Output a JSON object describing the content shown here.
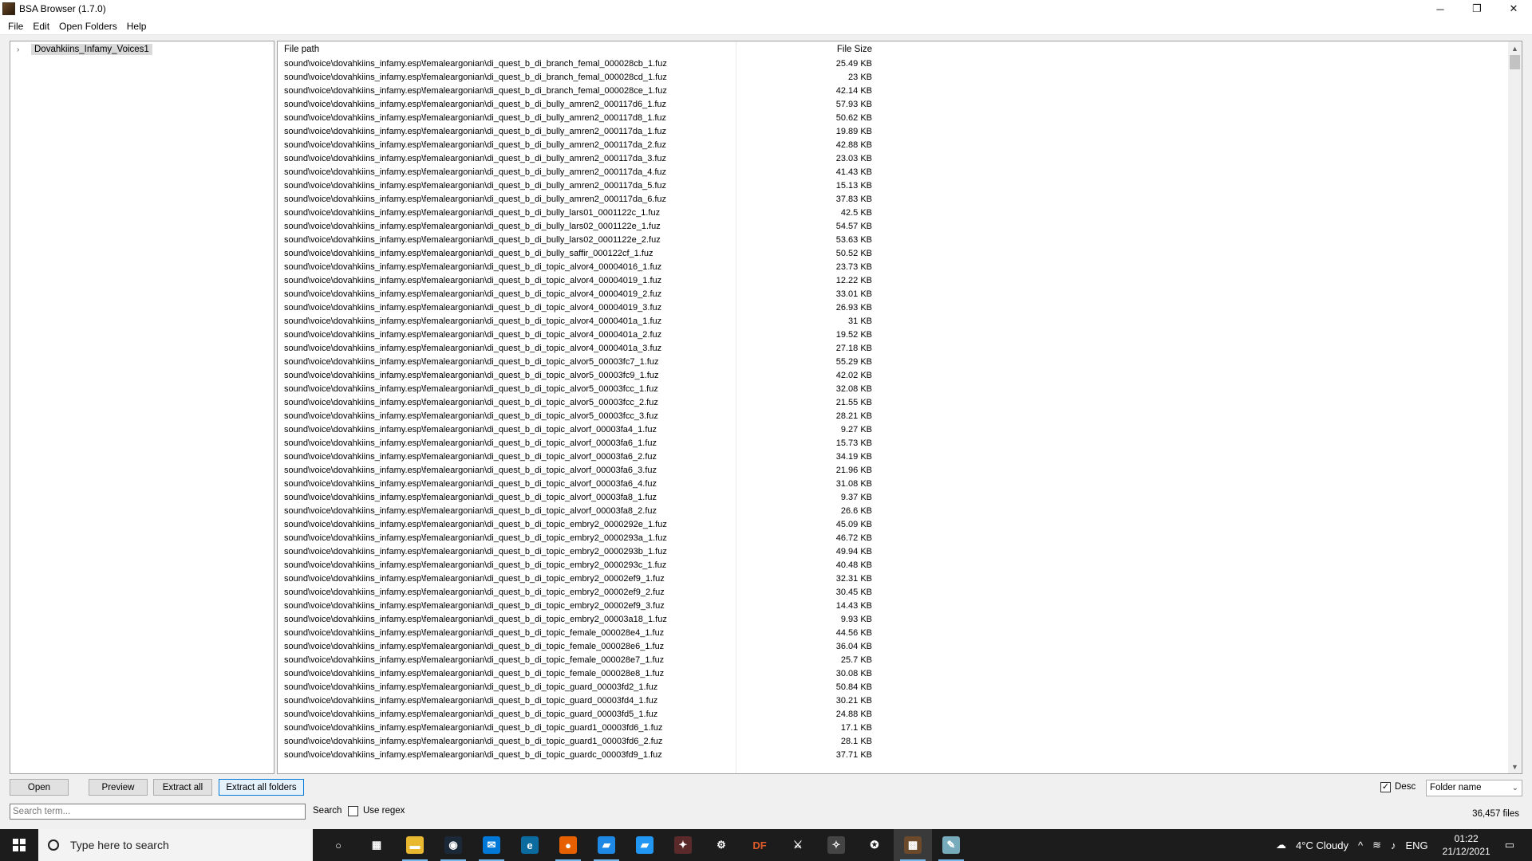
{
  "window": {
    "title": "BSA Browser (1.7.0)",
    "controls": {
      "minimize": "─",
      "maximize": "❐",
      "close": "✕"
    }
  },
  "menu": {
    "items": [
      "File",
      "Edit",
      "Open Folders",
      "Help"
    ]
  },
  "tree": {
    "root_label": "Dovahkiins_Infamy_Voices1",
    "expand_glyph": "›"
  },
  "list": {
    "headers": {
      "path": "File path",
      "size": "File Size"
    },
    "rows": [
      {
        "path": "sound\\voice\\dovahkiins_infamy.esp\\femaleargonian\\di_quest_b_di_branch_femal_000028cb_1.fuz",
        "size": "25.49 KB"
      },
      {
        "path": "sound\\voice\\dovahkiins_infamy.esp\\femaleargonian\\di_quest_b_di_branch_femal_000028cd_1.fuz",
        "size": "23 KB"
      },
      {
        "path": "sound\\voice\\dovahkiins_infamy.esp\\femaleargonian\\di_quest_b_di_branch_femal_000028ce_1.fuz",
        "size": "42.14 KB"
      },
      {
        "path": "sound\\voice\\dovahkiins_infamy.esp\\femaleargonian\\di_quest_b_di_bully_amren2_000117d6_1.fuz",
        "size": "57.93 KB"
      },
      {
        "path": "sound\\voice\\dovahkiins_infamy.esp\\femaleargonian\\di_quest_b_di_bully_amren2_000117d8_1.fuz",
        "size": "50.62 KB"
      },
      {
        "path": "sound\\voice\\dovahkiins_infamy.esp\\femaleargonian\\di_quest_b_di_bully_amren2_000117da_1.fuz",
        "size": "19.89 KB"
      },
      {
        "path": "sound\\voice\\dovahkiins_infamy.esp\\femaleargonian\\di_quest_b_di_bully_amren2_000117da_2.fuz",
        "size": "42.88 KB"
      },
      {
        "path": "sound\\voice\\dovahkiins_infamy.esp\\femaleargonian\\di_quest_b_di_bully_amren2_000117da_3.fuz",
        "size": "23.03 KB"
      },
      {
        "path": "sound\\voice\\dovahkiins_infamy.esp\\femaleargonian\\di_quest_b_di_bully_amren2_000117da_4.fuz",
        "size": "41.43 KB"
      },
      {
        "path": "sound\\voice\\dovahkiins_infamy.esp\\femaleargonian\\di_quest_b_di_bully_amren2_000117da_5.fuz",
        "size": "15.13 KB"
      },
      {
        "path": "sound\\voice\\dovahkiins_infamy.esp\\femaleargonian\\di_quest_b_di_bully_amren2_000117da_6.fuz",
        "size": "37.83 KB"
      },
      {
        "path": "sound\\voice\\dovahkiins_infamy.esp\\femaleargonian\\di_quest_b_di_bully_lars01_0001122c_1.fuz",
        "size": "42.5 KB"
      },
      {
        "path": "sound\\voice\\dovahkiins_infamy.esp\\femaleargonian\\di_quest_b_di_bully_lars02_0001122e_1.fuz",
        "size": "54.57 KB"
      },
      {
        "path": "sound\\voice\\dovahkiins_infamy.esp\\femaleargonian\\di_quest_b_di_bully_lars02_0001122e_2.fuz",
        "size": "53.63 KB"
      },
      {
        "path": "sound\\voice\\dovahkiins_infamy.esp\\femaleargonian\\di_quest_b_di_bully_saffir_000122cf_1.fuz",
        "size": "50.52 KB"
      },
      {
        "path": "sound\\voice\\dovahkiins_infamy.esp\\femaleargonian\\di_quest_b_di_topic_alvor4_00004016_1.fuz",
        "size": "23.73 KB"
      },
      {
        "path": "sound\\voice\\dovahkiins_infamy.esp\\femaleargonian\\di_quest_b_di_topic_alvor4_00004019_1.fuz",
        "size": "12.22 KB"
      },
      {
        "path": "sound\\voice\\dovahkiins_infamy.esp\\femaleargonian\\di_quest_b_di_topic_alvor4_00004019_2.fuz",
        "size": "33.01 KB"
      },
      {
        "path": "sound\\voice\\dovahkiins_infamy.esp\\femaleargonian\\di_quest_b_di_topic_alvor4_00004019_3.fuz",
        "size": "26.93 KB"
      },
      {
        "path": "sound\\voice\\dovahkiins_infamy.esp\\femaleargonian\\di_quest_b_di_topic_alvor4_0000401a_1.fuz",
        "size": "31 KB"
      },
      {
        "path": "sound\\voice\\dovahkiins_infamy.esp\\femaleargonian\\di_quest_b_di_topic_alvor4_0000401a_2.fuz",
        "size": "19.52 KB"
      },
      {
        "path": "sound\\voice\\dovahkiins_infamy.esp\\femaleargonian\\di_quest_b_di_topic_alvor4_0000401a_3.fuz",
        "size": "27.18 KB"
      },
      {
        "path": "sound\\voice\\dovahkiins_infamy.esp\\femaleargonian\\di_quest_b_di_topic_alvor5_00003fc7_1.fuz",
        "size": "55.29 KB"
      },
      {
        "path": "sound\\voice\\dovahkiins_infamy.esp\\femaleargonian\\di_quest_b_di_topic_alvor5_00003fc9_1.fuz",
        "size": "42.02 KB"
      },
      {
        "path": "sound\\voice\\dovahkiins_infamy.esp\\femaleargonian\\di_quest_b_di_topic_alvor5_00003fcc_1.fuz",
        "size": "32.08 KB"
      },
      {
        "path": "sound\\voice\\dovahkiins_infamy.esp\\femaleargonian\\di_quest_b_di_topic_alvor5_00003fcc_2.fuz",
        "size": "21.55 KB"
      },
      {
        "path": "sound\\voice\\dovahkiins_infamy.esp\\femaleargonian\\di_quest_b_di_topic_alvor5_00003fcc_3.fuz",
        "size": "28.21 KB"
      },
      {
        "path": "sound\\voice\\dovahkiins_infamy.esp\\femaleargonian\\di_quest_b_di_topic_alvorf_00003fa4_1.fuz",
        "size": "9.27 KB"
      },
      {
        "path": "sound\\voice\\dovahkiins_infamy.esp\\femaleargonian\\di_quest_b_di_topic_alvorf_00003fa6_1.fuz",
        "size": "15.73 KB"
      },
      {
        "path": "sound\\voice\\dovahkiins_infamy.esp\\femaleargonian\\di_quest_b_di_topic_alvorf_00003fa6_2.fuz",
        "size": "34.19 KB"
      },
      {
        "path": "sound\\voice\\dovahkiins_infamy.esp\\femaleargonian\\di_quest_b_di_topic_alvorf_00003fa6_3.fuz",
        "size": "21.96 KB"
      },
      {
        "path": "sound\\voice\\dovahkiins_infamy.esp\\femaleargonian\\di_quest_b_di_topic_alvorf_00003fa6_4.fuz",
        "size": "31.08 KB"
      },
      {
        "path": "sound\\voice\\dovahkiins_infamy.esp\\femaleargonian\\di_quest_b_di_topic_alvorf_00003fa8_1.fuz",
        "size": "9.37 KB"
      },
      {
        "path": "sound\\voice\\dovahkiins_infamy.esp\\femaleargonian\\di_quest_b_di_topic_alvorf_00003fa8_2.fuz",
        "size": "26.6 KB"
      },
      {
        "path": "sound\\voice\\dovahkiins_infamy.esp\\femaleargonian\\di_quest_b_di_topic_embry2_0000292e_1.fuz",
        "size": "45.09 KB"
      },
      {
        "path": "sound\\voice\\dovahkiins_infamy.esp\\femaleargonian\\di_quest_b_di_topic_embry2_0000293a_1.fuz",
        "size": "46.72 KB"
      },
      {
        "path": "sound\\voice\\dovahkiins_infamy.esp\\femaleargonian\\di_quest_b_di_topic_embry2_0000293b_1.fuz",
        "size": "49.94 KB"
      },
      {
        "path": "sound\\voice\\dovahkiins_infamy.esp\\femaleargonian\\di_quest_b_di_topic_embry2_0000293c_1.fuz",
        "size": "40.48 KB"
      },
      {
        "path": "sound\\voice\\dovahkiins_infamy.esp\\femaleargonian\\di_quest_b_di_topic_embry2_00002ef9_1.fuz",
        "size": "32.31 KB"
      },
      {
        "path": "sound\\voice\\dovahkiins_infamy.esp\\femaleargonian\\di_quest_b_di_topic_embry2_00002ef9_2.fuz",
        "size": "30.45 KB"
      },
      {
        "path": "sound\\voice\\dovahkiins_infamy.esp\\femaleargonian\\di_quest_b_di_topic_embry2_00002ef9_3.fuz",
        "size": "14.43 KB"
      },
      {
        "path": "sound\\voice\\dovahkiins_infamy.esp\\femaleargonian\\di_quest_b_di_topic_embry2_00003a18_1.fuz",
        "size": "9.93 KB"
      },
      {
        "path": "sound\\voice\\dovahkiins_infamy.esp\\femaleargonian\\di_quest_b_di_topic_female_000028e4_1.fuz",
        "size": "44.56 KB"
      },
      {
        "path": "sound\\voice\\dovahkiins_infamy.esp\\femaleargonian\\di_quest_b_di_topic_female_000028e6_1.fuz",
        "size": "36.04 KB"
      },
      {
        "path": "sound\\voice\\dovahkiins_infamy.esp\\femaleargonian\\di_quest_b_di_topic_female_000028e7_1.fuz",
        "size": "25.7 KB"
      },
      {
        "path": "sound\\voice\\dovahkiins_infamy.esp\\femaleargonian\\di_quest_b_di_topic_female_000028e8_1.fuz",
        "size": "30.08 KB"
      },
      {
        "path": "sound\\voice\\dovahkiins_infamy.esp\\femaleargonian\\di_quest_b_di_topic_guard_00003fd2_1.fuz",
        "size": "50.84 KB"
      },
      {
        "path": "sound\\voice\\dovahkiins_infamy.esp\\femaleargonian\\di_quest_b_di_topic_guard_00003fd4_1.fuz",
        "size": "30.21 KB"
      },
      {
        "path": "sound\\voice\\dovahkiins_infamy.esp\\femaleargonian\\di_quest_b_di_topic_guard_00003fd5_1.fuz",
        "size": "24.88 KB"
      },
      {
        "path": "sound\\voice\\dovahkiins_infamy.esp\\femaleargonian\\di_quest_b_di_topic_guard1_00003fd6_1.fuz",
        "size": "17.1 KB"
      },
      {
        "path": "sound\\voice\\dovahkiins_infamy.esp\\femaleargonian\\di_quest_b_di_topic_guard1_00003fd6_2.fuz",
        "size": "28.1 KB"
      },
      {
        "path": "sound\\voice\\dovahkiins_infamy.esp\\femaleargonian\\di_quest_b_di_topic_guardc_00003fd9_1.fuz",
        "size": "37.71 KB"
      }
    ]
  },
  "buttons": {
    "open": "Open",
    "preview": "Preview",
    "extract_all": "Extract all",
    "extract_all_folders": "Extract all folders"
  },
  "sort": {
    "desc_label": "Desc",
    "desc_checked": true,
    "check_glyph": "✓",
    "combo_value": "Folder name",
    "combo_arrow": "⌄"
  },
  "search": {
    "placeholder": "Search term...",
    "label": "Search",
    "regex_label": "Use regex"
  },
  "status": {
    "file_count": "36,457 files"
  },
  "taskbar": {
    "search_placeholder": "Type here to search",
    "apps": [
      {
        "name": "cortana-icon",
        "glyph": "○",
        "color": "transparent"
      },
      {
        "name": "task-view-icon",
        "glyph": "▦",
        "color": "transparent"
      },
      {
        "name": "file-explorer-icon",
        "glyph": "▬",
        "color": "#e8b830"
      },
      {
        "name": "steam-icon",
        "glyph": "◉",
        "color": "#1b2838"
      },
      {
        "name": "mail-icon",
        "glyph": "✉",
        "color": "#0078d7"
      },
      {
        "name": "edge-icon",
        "glyph": "e",
        "color": "#0b6a9e"
      },
      {
        "name": "firefox-icon",
        "glyph": "●",
        "color": "#e66000"
      },
      {
        "name": "app-blue-icon",
        "glyph": "▰",
        "color": "#1e88e5"
      },
      {
        "name": "app-blue2-icon",
        "glyph": "▰",
        "color": "#2196f3"
      },
      {
        "name": "game-icon",
        "glyph": "✦",
        "color": "#5a2a2a"
      },
      {
        "name": "settings-icon",
        "glyph": "⚙",
        "color": "transparent"
      },
      {
        "name": "df-icon",
        "glyph": "DF",
        "color": "transparent"
      },
      {
        "name": "sword-icon",
        "glyph": "⚔",
        "color": "transparent"
      },
      {
        "name": "tool-icon",
        "glyph": "✧",
        "color": "#444"
      },
      {
        "name": "launcher-icon",
        "glyph": "✪",
        "color": "transparent"
      },
      {
        "name": "bsa-browser-icon",
        "glyph": "▩",
        "color": "#6a4a2a"
      },
      {
        "name": "pen-app-icon",
        "glyph": "✎",
        "color": "#7ab"
      }
    ],
    "weather": "4°C  Cloudy",
    "lang": "ENG",
    "time": "01:22",
    "date": "21/12/2021"
  }
}
